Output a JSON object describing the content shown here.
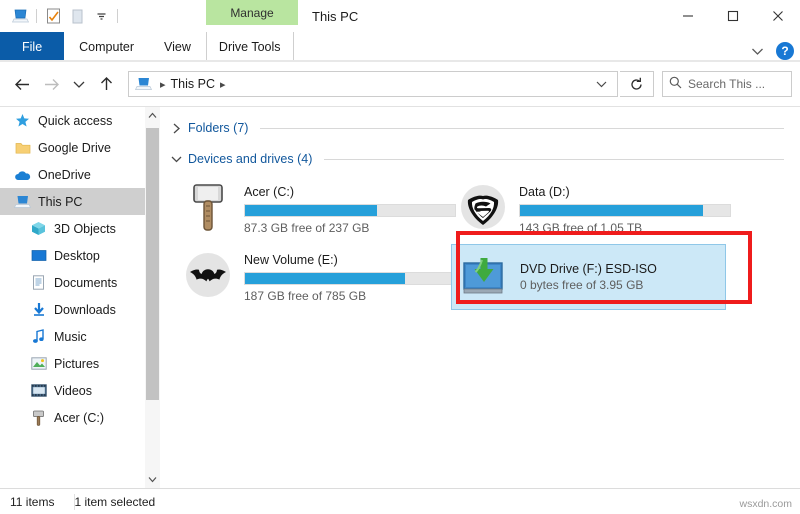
{
  "window": {
    "title": "This PC",
    "contextual_tab_group": "Manage",
    "minimize_label": "Minimize",
    "maximize_label": "Maximize",
    "close_label": "Close"
  },
  "quick_access_toolbar": {
    "items": [
      {
        "name": "this-pc-icon",
        "label": "This PC"
      },
      {
        "name": "properties-icon",
        "label": "Properties"
      },
      {
        "name": "new-folder-icon",
        "label": "New folder"
      },
      {
        "name": "customize-dropdown-icon",
        "label": "Customize Quick Access Toolbar"
      }
    ]
  },
  "ribbon": {
    "tabs": [
      {
        "label": "File",
        "active": true
      },
      {
        "label": "Computer",
        "active": false
      },
      {
        "label": "View",
        "active": false
      },
      {
        "label": "Drive Tools",
        "active": false,
        "contextual": true
      }
    ],
    "collapse_label": "Minimize the Ribbon",
    "help_label": "?"
  },
  "address_bar": {
    "back_label": "Back",
    "forward_label": "Forward",
    "recent_label": "Recent locations",
    "up_label": "Up",
    "breadcrumb": [
      "This PC"
    ],
    "refresh_label": "Refresh",
    "dropdown_label": "Previous locations"
  },
  "search": {
    "placeholder": "Search This ...",
    "value": ""
  },
  "sidebar": {
    "items": [
      {
        "label": "Quick access",
        "icon": "star-icon",
        "indent": false,
        "selected": false
      },
      {
        "label": "Google Drive",
        "icon": "folder-icon",
        "indent": false,
        "selected": false
      },
      {
        "label": "OneDrive",
        "icon": "cloud-icon",
        "indent": false,
        "selected": false
      },
      {
        "label": "This PC",
        "icon": "pc-icon",
        "indent": false,
        "selected": true
      },
      {
        "label": "3D Objects",
        "icon": "cube-icon",
        "indent": true,
        "selected": false
      },
      {
        "label": "Desktop",
        "icon": "desktop-icon",
        "indent": true,
        "selected": false
      },
      {
        "label": "Documents",
        "icon": "document-icon",
        "indent": true,
        "selected": false
      },
      {
        "label": "Downloads",
        "icon": "download-icon",
        "indent": true,
        "selected": false
      },
      {
        "label": "Music",
        "icon": "music-note-icon",
        "indent": true,
        "selected": false
      },
      {
        "label": "Pictures",
        "icon": "picture-icon",
        "indent": true,
        "selected": false
      },
      {
        "label": "Videos",
        "icon": "video-icon",
        "indent": true,
        "selected": false
      },
      {
        "label": "Acer (C:)",
        "icon": "hammer-drive-icon",
        "indent": true,
        "selected": false
      }
    ]
  },
  "content": {
    "groups": [
      {
        "title": "Folders (7)",
        "expanded": false
      },
      {
        "title": "Devices and drives (4)",
        "expanded": true
      }
    ],
    "drives": [
      {
        "name": "Acer (C:)",
        "icon": "hammer-drive-icon",
        "free_text": "87.3 GB free of 237 GB",
        "used_percent": 63,
        "selected": false
      },
      {
        "name": "Data (D:)",
        "icon": "superman-drive-icon",
        "free_text": "143 GB free of 1.05 TB",
        "used_percent": 87,
        "selected": false
      },
      {
        "name": "New Volume (E:)",
        "icon": "batman-drive-icon",
        "free_text": "187 GB free of 785 GB",
        "used_percent": 76,
        "selected": false
      },
      {
        "name": "DVD Drive (F:) ESD-ISO",
        "icon": "dvd-drive-icon",
        "free_text": "0 bytes free of 3.95 GB",
        "used_percent": 100,
        "selected": true,
        "has_bar": false
      }
    ]
  },
  "annotation": {
    "color": "#ef1c1c",
    "target": "DVD Drive (F:) ESD-ISO"
  },
  "status_bar": {
    "item_count": "11 items",
    "selection": "1 item selected"
  },
  "watermark": "wsxdn.com",
  "colors": {
    "accent_blue": "#26a0da",
    "file_tab_blue": "#0b5ca8",
    "contextual_green": "#b9e5a0",
    "selection_blue": "#cce8f7",
    "annotation_red": "#ef1c1c"
  }
}
